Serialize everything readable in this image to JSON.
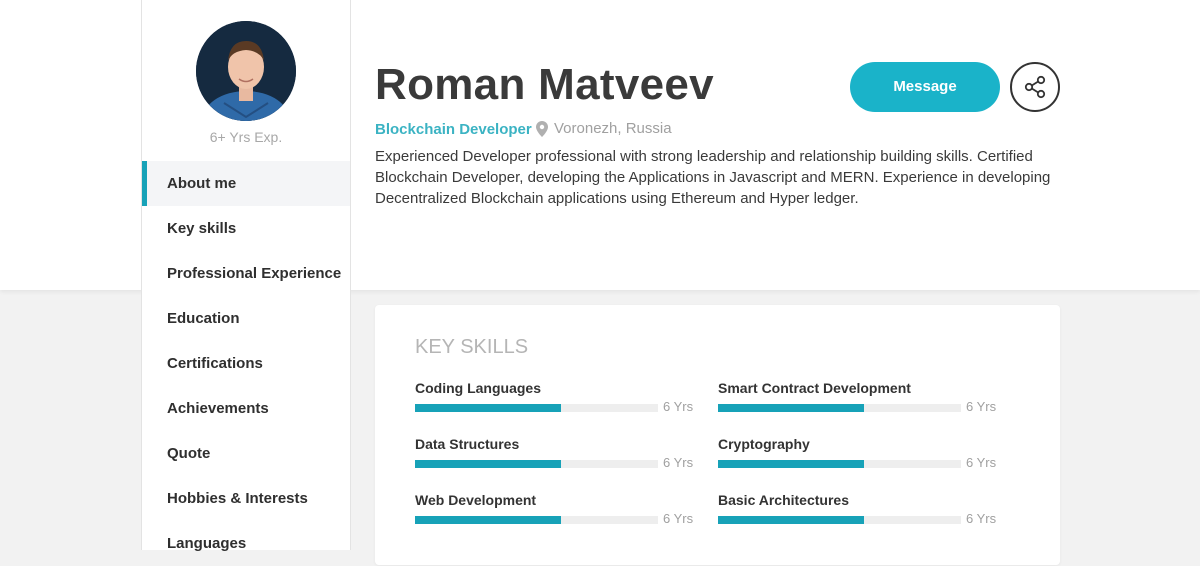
{
  "profile": {
    "name": "Roman Matveev",
    "role": "Blockchain Developer",
    "location": "Voronezh, Russia",
    "experience": "6+ Yrs Exp.",
    "bio": "Experienced Developer professional with strong leadership and relationship building skills. Certified Blockchain Developer, developing the Applications in Javascript and MERN. Experience in developing Decentralized Blockchain applications using Ethereum and Hyper ledger."
  },
  "actions": {
    "message_label": "Message",
    "share_icon": "share-icon"
  },
  "nav": {
    "items": [
      {
        "label": "About me",
        "active": true
      },
      {
        "label": "Key skills"
      },
      {
        "label": "Professional Experience"
      },
      {
        "label": "Education"
      },
      {
        "label": "Certifications"
      },
      {
        "label": "Achievements"
      },
      {
        "label": "Quote"
      },
      {
        "label": "Hobbies & Interests"
      },
      {
        "label": "Languages"
      }
    ]
  },
  "skills_card": {
    "title": "KEY SKILLS",
    "skills": [
      {
        "name": "Coding Languages",
        "years": "6 Yrs",
        "level": 0.6
      },
      {
        "name": "Smart Contract Development",
        "years": "6 Yrs",
        "level": 0.6
      },
      {
        "name": "Data Structures",
        "years": "6 Yrs",
        "level": 0.6
      },
      {
        "name": "Cryptography",
        "years": "6 Yrs",
        "level": 0.6
      },
      {
        "name": "Web Development",
        "years": "6 Yrs",
        "level": 0.6
      },
      {
        "name": "Basic Architectures",
        "years": "6 Yrs",
        "level": 0.6
      }
    ]
  },
  "colors": {
    "accent": "#17a2b8",
    "message_button": "#1ab3c9",
    "role_text": "#3bb3c3"
  }
}
